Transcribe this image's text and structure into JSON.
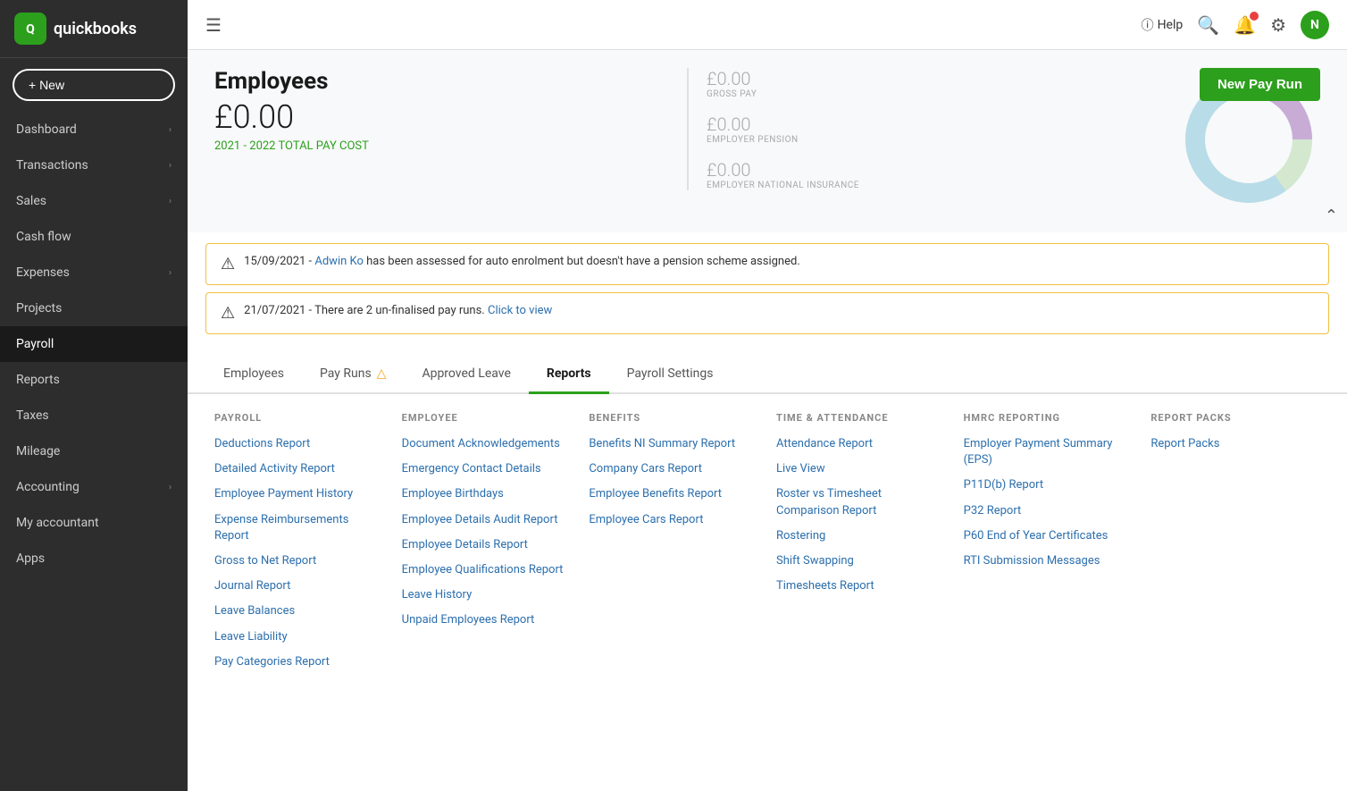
{
  "sidebar": {
    "logo_letter": "Q",
    "brand_name": "quickbooks",
    "new_button_label": "+ New",
    "items": [
      {
        "id": "dashboard",
        "label": "Dashboard",
        "has_arrow": true,
        "active": false
      },
      {
        "id": "transactions",
        "label": "Transactions",
        "has_arrow": true,
        "active": false
      },
      {
        "id": "sales",
        "label": "Sales",
        "has_arrow": true,
        "active": false
      },
      {
        "id": "cashflow",
        "label": "Cash flow",
        "has_arrow": false,
        "active": false
      },
      {
        "id": "expenses",
        "label": "Expenses",
        "has_arrow": true,
        "active": false
      },
      {
        "id": "projects",
        "label": "Projects",
        "has_arrow": false,
        "active": false
      },
      {
        "id": "payroll",
        "label": "Payroll",
        "has_arrow": false,
        "active": true
      },
      {
        "id": "reports",
        "label": "Reports",
        "has_arrow": false,
        "active": false
      },
      {
        "id": "taxes",
        "label": "Taxes",
        "has_arrow": false,
        "active": false
      },
      {
        "id": "mileage",
        "label": "Mileage",
        "has_arrow": false,
        "active": false
      },
      {
        "id": "accounting",
        "label": "Accounting",
        "has_arrow": true,
        "active": false
      },
      {
        "id": "my-accountant",
        "label": "My accountant",
        "has_arrow": false,
        "active": false
      },
      {
        "id": "apps",
        "label": "Apps",
        "has_arrow": false,
        "active": false
      }
    ]
  },
  "topbar": {
    "help_label": "Help",
    "avatar_letter": "N"
  },
  "header": {
    "title": "Employees",
    "total_amount": "£0.00",
    "total_label": "2021 - 2022 TOTAL PAY COST",
    "stats": [
      {
        "value": "£0.00",
        "label": "GROSS PAY"
      },
      {
        "value": "£0.00",
        "label": "EMPLOYER PENSION"
      },
      {
        "value": "£0.00",
        "label": "EMPLOYER NATIONAL INSURANCE"
      }
    ],
    "new_pay_run_label": "New Pay Run"
  },
  "alerts": [
    {
      "date": "15/09/2021",
      "link_text": "Adwin Ko",
      "message": " has been assessed for auto enrolment but doesn't have a pension scheme assigned."
    },
    {
      "date": "21/07/2021",
      "message": " - There are 2 un-finalised pay runs.",
      "link_text": "Click to view"
    }
  ],
  "tabs": [
    {
      "id": "employees",
      "label": "Employees",
      "active": false,
      "warn": false
    },
    {
      "id": "pay-runs",
      "label": "Pay Runs",
      "active": false,
      "warn": true
    },
    {
      "id": "approved-leave",
      "label": "Approved Leave",
      "active": false,
      "warn": false
    },
    {
      "id": "reports",
      "label": "Reports",
      "active": true,
      "warn": false
    },
    {
      "id": "payroll-settings",
      "label": "Payroll Settings",
      "active": false,
      "warn": false
    }
  ],
  "reports": {
    "columns": [
      {
        "header": "PAYROLL",
        "links": [
          "Deductions Report",
          "Detailed Activity Report",
          "Employee Payment History",
          "Expense Reimbursements Report",
          "Gross to Net Report",
          "Journal Report",
          "Leave Balances",
          "Leave Liability",
          "Pay Categories Report"
        ]
      },
      {
        "header": "EMPLOYEE",
        "links": [
          "Document Acknowledgements",
          "Emergency Contact Details",
          "Employee Birthdays",
          "Employee Details Audit Report",
          "Employee Details Report",
          "Employee Qualifications Report",
          "Leave History",
          "Unpaid Employees Report"
        ]
      },
      {
        "header": "BENEFITS",
        "links": [
          "Benefits NI Summary Report",
          "Company Cars Report",
          "Employee Benefits Report",
          "Employee Cars Report"
        ]
      },
      {
        "header": "TIME & ATTENDANCE",
        "links": [
          "Attendance Report",
          "Live View",
          "Roster vs Timesheet Comparison Report",
          "Rostering",
          "Shift Swapping",
          "Timesheets Report"
        ]
      },
      {
        "header": "HMRC REPORTING",
        "links": [
          "Employer Payment Summary (EPS)",
          "P11D(b) Report",
          "P32 Report",
          "P60 End of Year Certificates",
          "RTI Submission Messages"
        ]
      },
      {
        "header": "REPORT PACKS",
        "links": [
          "Report Packs"
        ]
      }
    ]
  }
}
